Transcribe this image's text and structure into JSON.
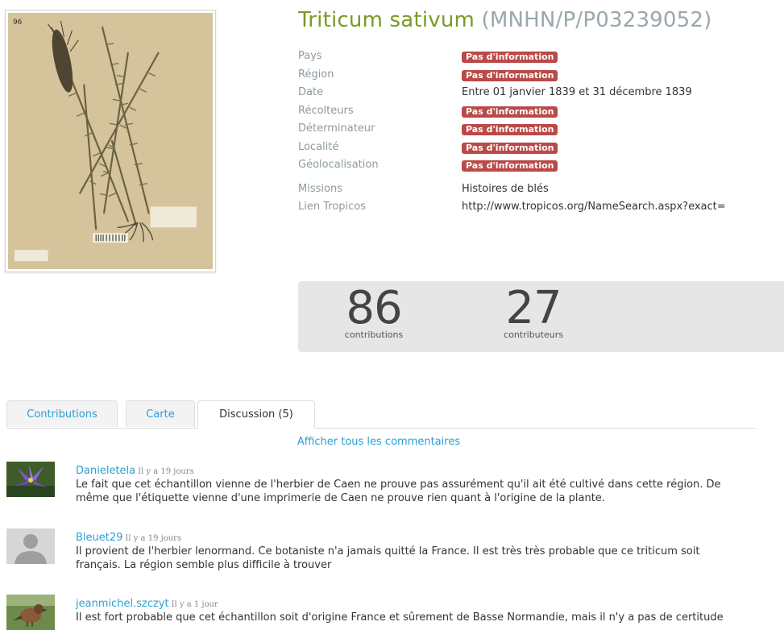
{
  "specimen": {
    "species": "Triticum sativum",
    "code": "(MNHN/P/P03239052)",
    "image_alt": "herbarium-sheet-wheat",
    "sheet_mark": "96"
  },
  "meta": {
    "rows": [
      {
        "label": "Pays",
        "value": "Pas d'information",
        "kind": "badge"
      },
      {
        "label": "Région",
        "value": "Pas d'information",
        "kind": "badge"
      },
      {
        "label": "Date",
        "value": "Entre 01 janvier 1839 et 31 décembre 1839",
        "kind": "text"
      },
      {
        "label": "Récolteurs",
        "value": "Pas d'information",
        "kind": "badge"
      },
      {
        "label": "Déterminateur",
        "value": "Pas d'information",
        "kind": "badge"
      },
      {
        "label": "Localité",
        "value": "Pas d'information",
        "kind": "badge"
      },
      {
        "label": "Géolocalisation",
        "value": "Pas d'information",
        "kind": "badge"
      }
    ],
    "missions_label": "Missions",
    "missions_value": "Histoires de blés",
    "tropicos_label": "Lien Tropicos",
    "tropicos_value": "http://www.tropicos.org/NameSearch.aspx?exact="
  },
  "stats": {
    "contributions_count": "86",
    "contributions_label": "contributions",
    "contributors_count": "27",
    "contributors_label": "contributeurs"
  },
  "tabs": [
    {
      "label": "Contributions",
      "active": false
    },
    {
      "label": "Carte",
      "active": false
    },
    {
      "label": "Discussion (5)",
      "active": true
    }
  ],
  "discussion": {
    "show_all": "Afficher tous les commentaires",
    "comments": [
      {
        "author": "Danieletela",
        "time": "Il y a 19 jours",
        "text": "Le fait que cet échantillon vienne de l'herbier de Caen ne prouve pas assurément qu'il ait été cultivé dans cette région. De même que l'étiquette vienne d'une imprimerie de Caen ne prouve rien quant à l'origine de la plante.",
        "avatar": "iris-flower-photo"
      },
      {
        "author": "Bleuet29",
        "time": "Il y a 19 jours",
        "text": "Il provient de l'herbier lenormand. Ce botaniste n'a jamais quitté la France. Il est très très probable que ce triticum soit français. La région semble plus difficile à trouver",
        "avatar": "default-user-silhouette"
      },
      {
        "author": "jeanmichel.szczyt",
        "time": "Il y a 1 jour",
        "text": "Il est fort probable que cet échantillon soit d'origine France et sûrement de Basse Normandie, mais il n'y a pas de certitude",
        "avatar": "bird-photo"
      }
    ]
  },
  "colors": {
    "species": "#7a9a24",
    "code": "#9aa7ac",
    "label": "#8e9aa1",
    "badge": "#b94a48",
    "link": "#2a9fd6",
    "stats_bg": "#e6e6e6"
  }
}
